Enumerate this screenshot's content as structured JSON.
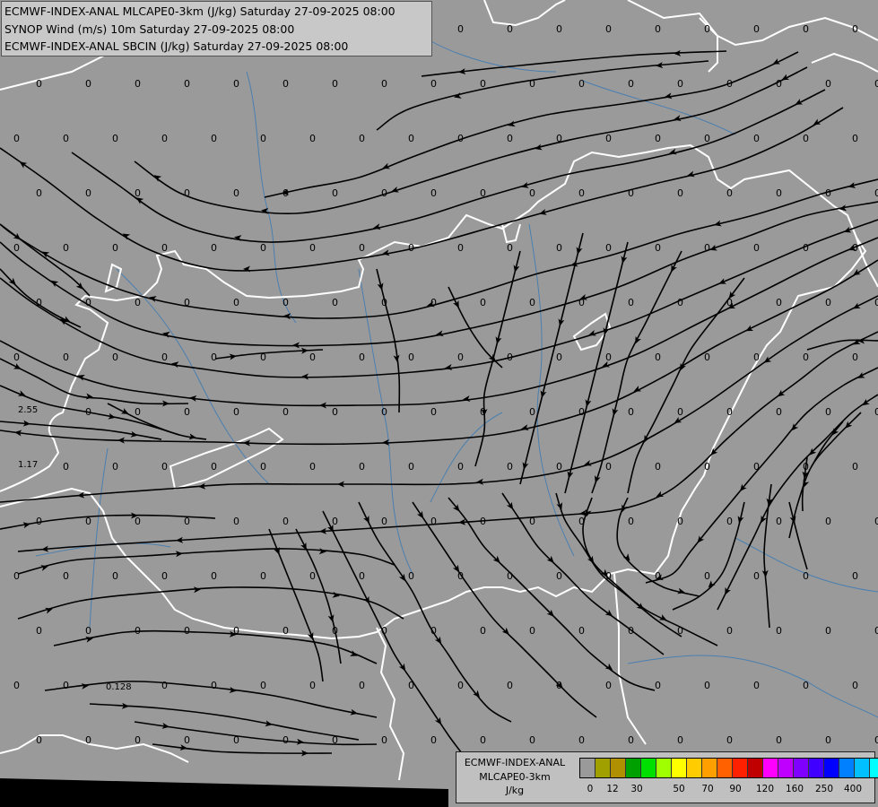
{
  "header": {
    "line1": "ECMWF-INDEX-ANAL MLCAPE0-3km (J/kg) Saturday 27-09-2025 08:00",
    "line2": "SYNOP Wind (m/s) 10m Saturday 27-09-2025 08:00",
    "line3": "ECMWF-INDEX-ANAL SBCIN (J/kg) Saturday 27-09-2025 08:00"
  },
  "legend": {
    "title_line1": "ECMWF-INDEX-ANAL",
    "title_line2": "MLCAPE0-3km",
    "units": "J/kg",
    "swatches": [
      "#9a9a9a",
      "#a0a000",
      "#b09000",
      "#00a000",
      "#00e000",
      "#a0ff00",
      "#ffff00",
      "#ffcc00",
      "#ffa000",
      "#ff6000",
      "#ff2000",
      "#c00000",
      "#ff00ff",
      "#c000ff",
      "#8000ff",
      "#4000ff",
      "#0000ff",
      "#0080ff",
      "#00c0ff",
      "#00ffff",
      "#80ffff",
      "#ffffff"
    ],
    "ticks": [
      "0",
      "12",
      "30",
      "50",
      "70",
      "90",
      "120",
      "160",
      "250",
      "400"
    ]
  },
  "colors": {
    "background": "#9a9a9a",
    "border": "#ffffff",
    "river": "#4a7fb0",
    "streamline": "#000000"
  },
  "labels": {
    "special": [
      "2.55",
      "1.17",
      "0.128"
    ]
  }
}
